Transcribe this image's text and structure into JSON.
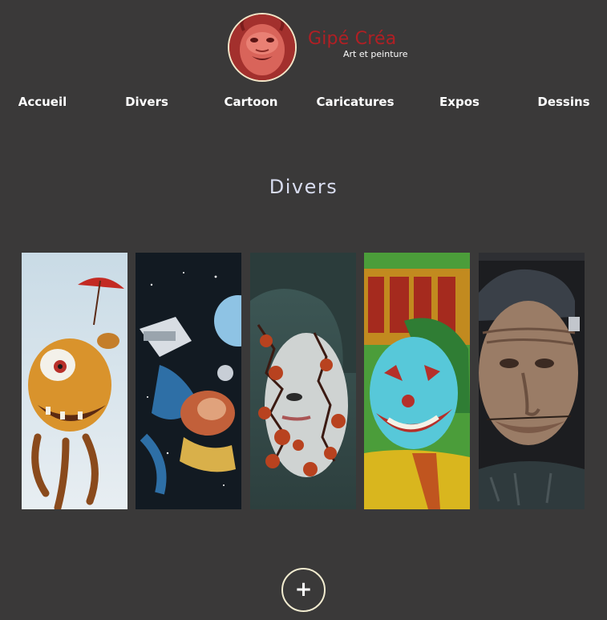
{
  "header": {
    "brand_name": "Gipé Créa",
    "tagline": "Art et peinture",
    "logo_icon": "red-creature-portrait-icon"
  },
  "nav": {
    "items": [
      {
        "label": "Accueil"
      },
      {
        "label": "Divers"
      },
      {
        "label": "Cartoon"
      },
      {
        "label": "Caricatures"
      },
      {
        "label": "Expos"
      },
      {
        "label": "Dessins"
      }
    ]
  },
  "section": {
    "title": "Divers"
  },
  "gallery": {
    "items": [
      {
        "image": "orange-monster-with-umbrella-painting"
      },
      {
        "image": "astronaut-robot-space-painting"
      },
      {
        "image": "woman-face-cracked-red-painting"
      },
      {
        "image": "joker-portrait-painting"
      },
      {
        "image": "frankenstein-caricature-painting"
      }
    ]
  },
  "more_button": {
    "icon": "plus-icon",
    "glyph": "+"
  },
  "colors": {
    "background": "#3a3939",
    "brand": "#b11f24",
    "title": "#d8dcef",
    "ring": "#f2ecd0"
  }
}
